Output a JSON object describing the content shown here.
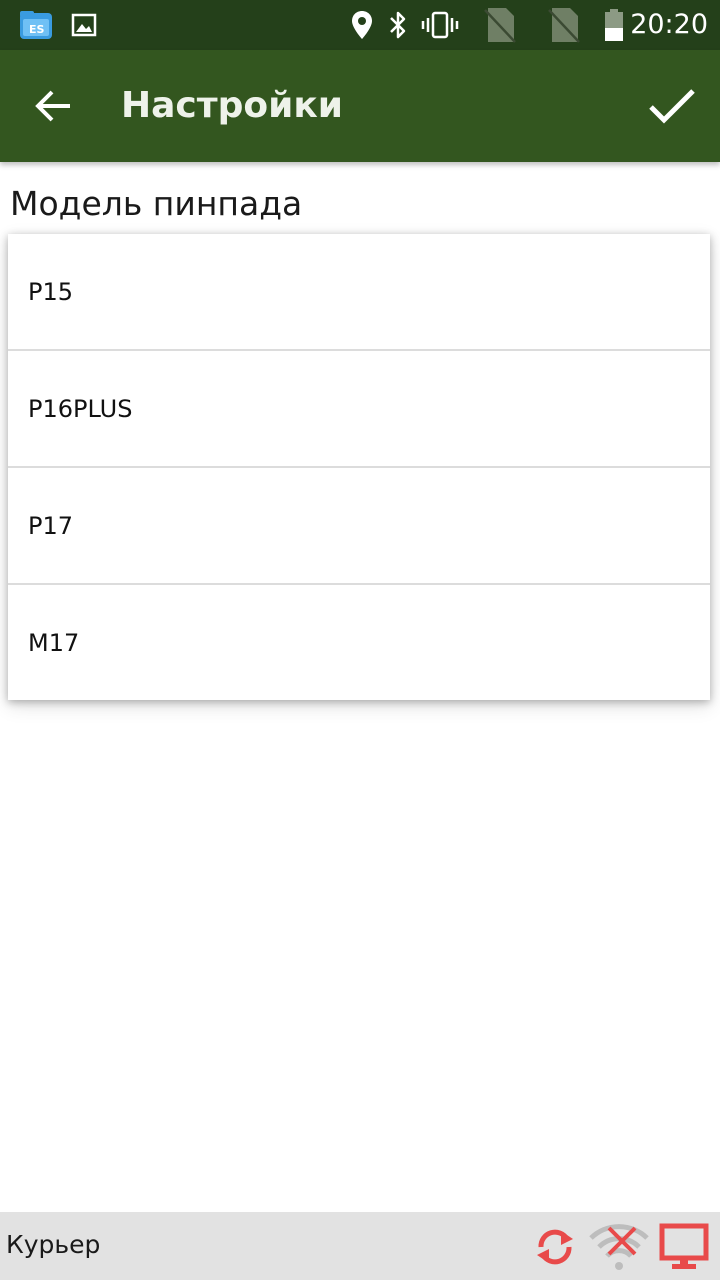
{
  "status_bar": {
    "time": "20:20",
    "icons": [
      "es-file-explorer-icon",
      "gallery-icon",
      "location-icon",
      "bluetooth-icon",
      "vibrate-icon",
      "no-sim-icon",
      "no-sim-icon",
      "battery-icon"
    ]
  },
  "app_bar": {
    "title": "Настройки",
    "back_icon": "arrow-left-icon",
    "confirm_icon": "check-icon",
    "color": "#33561f"
  },
  "setting": {
    "label": "Модель пинпада",
    "options": [
      "P15",
      "P16PLUS",
      "P17",
      "M17"
    ]
  },
  "bottom_bar": {
    "label": "Курьер",
    "icons": [
      "sync-icon",
      "wifi-off-icon",
      "monitor-icon"
    ],
    "icon_color": "#e84a4a"
  }
}
